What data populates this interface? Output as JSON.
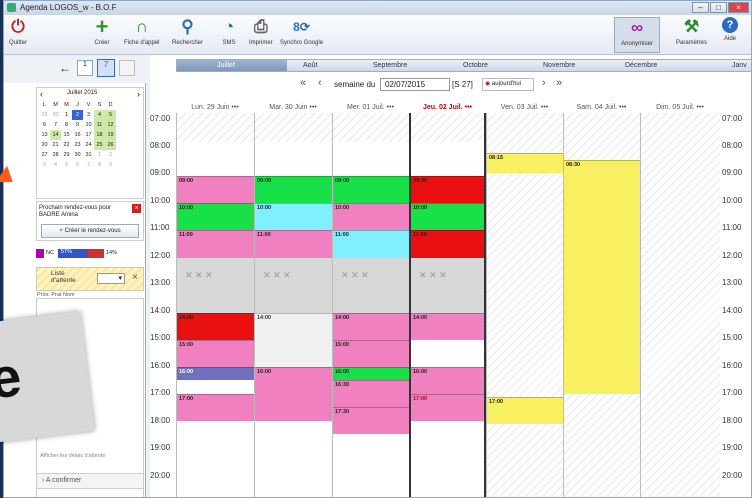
{
  "window": {
    "title": "Agenda LOGOS_w - B.O.F"
  },
  "toolbar": {
    "items": [
      {
        "label": "Quitter",
        "icon": "power-icon",
        "color": "#cc2222"
      },
      {
        "label": "Créer",
        "icon": "plus-icon",
        "color": "#2a9a2a"
      },
      {
        "label": "Fiche d'appel",
        "icon": "headset-icon",
        "color": "#2a8a2a"
      },
      {
        "label": "Rechercher",
        "icon": "magnifier-icon",
        "color": "#2a6ac0"
      },
      {
        "label": "SMS",
        "icon": "sms-icon",
        "color": "#2a6ac0"
      },
      {
        "label": "Imprimer",
        "icon": "printer-icon",
        "color": "#666666"
      },
      {
        "label": "Synchro Google",
        "icon": "google-sync-icon",
        "color": "#2a6ac0"
      }
    ],
    "right": [
      {
        "label": "Anonymiser",
        "icon": "mask-icon"
      },
      {
        "label": "Paramètres",
        "icon": "tools-icon"
      },
      {
        "label": "Aide",
        "icon": "help-icon"
      }
    ]
  },
  "minical": {
    "title": "Juillet 2015",
    "days": [
      "L",
      "M",
      "M",
      "J",
      "V",
      "S",
      "D"
    ],
    "weeks": [
      [
        "29",
        "30",
        "1",
        "2",
        "3",
        "4",
        "5"
      ],
      [
        "6",
        "7",
        "8",
        "9",
        "10",
        "11",
        "12"
      ],
      [
        "13",
        "14",
        "15",
        "16",
        "17",
        "18",
        "19"
      ],
      [
        "20",
        "21",
        "22",
        "23",
        "24",
        "25",
        "26"
      ],
      [
        "27",
        "28",
        "29",
        "30",
        "31",
        "1",
        "2"
      ],
      [
        "3",
        "4",
        "5",
        "6",
        "7",
        "8",
        "9"
      ]
    ]
  },
  "next_rdv": {
    "text": "Prochain rendez-vous pour BADRE Amina",
    "button": "Créer le rendez-vous"
  },
  "stats": {
    "nc": "NC",
    "p1": "57%",
    "p2": "14%"
  },
  "waitlist": {
    "title": "Liste d'attente",
    "cols": "Prior. Prat Nom",
    "footer": "Afficher les délais d'attente",
    "confirm": "A confirmer"
  },
  "months": [
    "Juillet",
    "Août",
    "Septembre",
    "Octobre",
    "Novembre",
    "Décembre",
    "Janv"
  ],
  "week": {
    "label": "semaine du",
    "date": "02/07/2015",
    "num": "[S 27]",
    "today": "aujourd'hui"
  },
  "days": [
    "Lun. 29 Juin",
    "Mar. 30 Juin",
    "Mer. 01 Juil.",
    "Jeu. 02 Juil.",
    "Ven. 03 Juil.",
    "Sam. 04 Juil.",
    "Dim. 05 Juil."
  ],
  "hours": [
    "07:00",
    "08:00",
    "09:00",
    "10:00",
    "11:00",
    "12:00",
    "13:00",
    "14:00",
    "15:00",
    "16:00",
    "17:00",
    "18:00",
    "19:00",
    "20:00"
  ],
  "overlay_text": "e"
}
